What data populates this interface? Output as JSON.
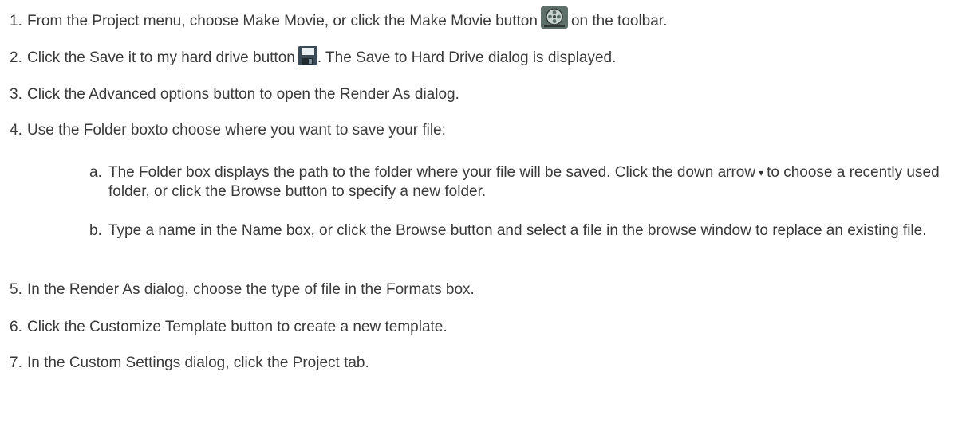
{
  "steps": [
    {
      "num": "1.",
      "text_a": "From the Project menu, choose Make Movie, or click the Make Movie button",
      "text_b": "on the toolbar."
    },
    {
      "num": "2.",
      "text_a": "Click the Save it to my hard drive button",
      "text_b": ". The Save to Hard Drive dialog is displayed."
    },
    {
      "num": "3.",
      "text": "Click the Advanced options button to open the Render As dialog."
    },
    {
      "num": "4.",
      "text": "Use the Folder boxto choose where you want to save your file:"
    },
    {
      "num": "5.",
      "text": "In the Render As dialog, choose the type of file in the Formats box."
    },
    {
      "num": "6.",
      "text": "Click the Customize Template button to create a new template."
    },
    {
      "num": "7.",
      "text": "In the Custom Settings dialog, click the Project tab."
    }
  ],
  "substeps": [
    {
      "letter": "a.",
      "text_a": "The Folder box displays the path to the folder where your file will be saved. Click the down arrow",
      "text_b": "to choose a recently used folder, or click the Browse button to specify a new folder."
    },
    {
      "letter": "b.",
      "text": "Type a name in the Name box, or click the Browse button and select a file in the browse window to replace an existing file."
    }
  ],
  "icons": {
    "make_movie": "film-reel-icon",
    "save": "floppy-disk-icon",
    "down_arrow": "▾"
  }
}
